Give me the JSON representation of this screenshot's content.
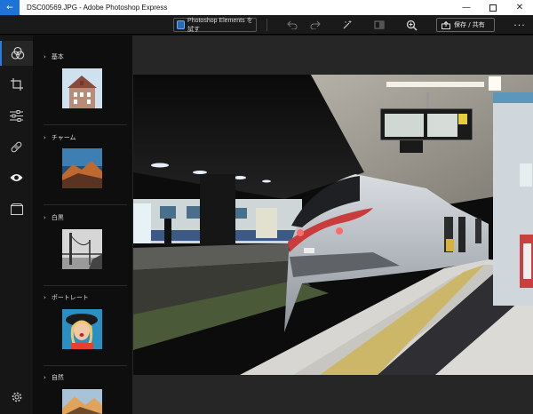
{
  "window": {
    "title": "DSC00569.JPG - Adobe Photoshop Express",
    "controls": [
      "minimize",
      "maximize",
      "close"
    ]
  },
  "toolbar": {
    "try_ps_label": "Photoshop Elements を試す",
    "share_label": "保存 / 共有",
    "more_label": "···",
    "icons": [
      "undo-icon",
      "redo-icon",
      "auto-fix-icon",
      "compare-icon",
      "zoom-icon"
    ]
  },
  "rail": {
    "items": [
      "looks-icon",
      "crop-icon",
      "adjust-icon",
      "heal-icon",
      "eye-icon",
      "border-icon"
    ],
    "active": "looks-icon",
    "settings": "settings-icon"
  },
  "presets": {
    "categories": [
      {
        "label": "基本"
      },
      {
        "label": "チャーム"
      },
      {
        "label": "白黒"
      },
      {
        "label": "ポートレート"
      },
      {
        "label": "自然"
      }
    ]
  },
  "colors": {
    "accent": "#2d7be0",
    "titlebar_back": "#1f73d6",
    "canvas_bg": "#262626",
    "panel_bg": "#0e0e0e"
  }
}
